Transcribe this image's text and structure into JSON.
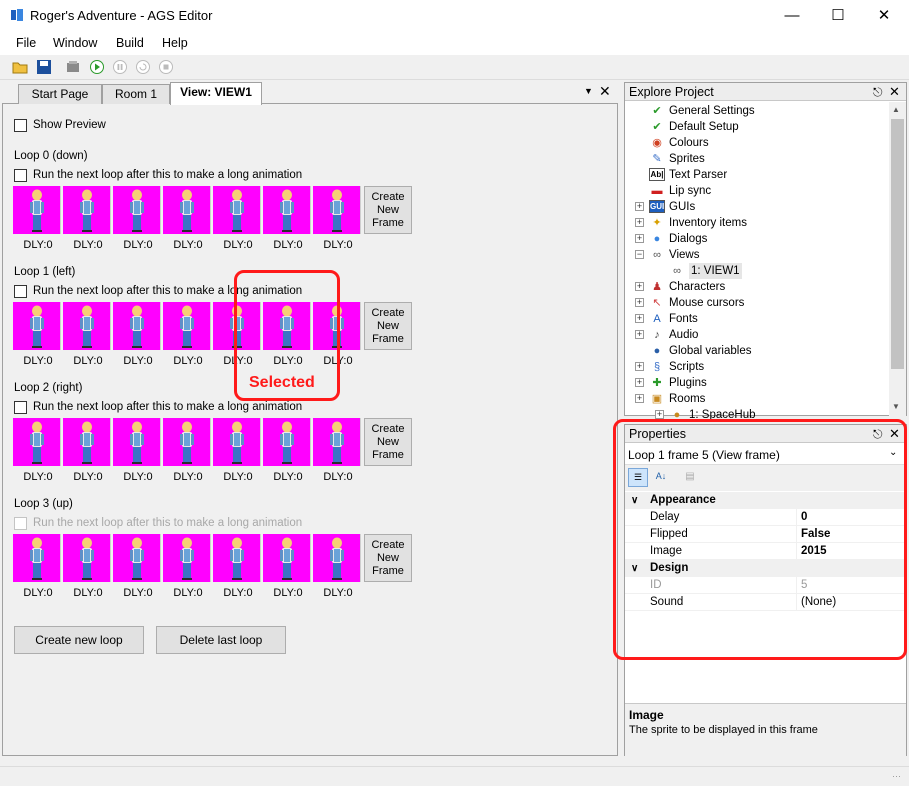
{
  "window": {
    "title": "Roger's Adventure - AGS Editor"
  },
  "menu": [
    "File",
    "Window",
    "Build",
    "Help"
  ],
  "tabs": [
    "Start Page",
    "Room 1",
    "View: VIEW1"
  ],
  "show_preview_label": "Show Preview",
  "run_next_label": "Run the next loop after this to make a long animation",
  "new_frame_label": [
    "Create",
    "New",
    "Frame"
  ],
  "delay_label": "DLY:0",
  "loops": [
    {
      "title": "Loop 0 (down)",
      "frames": 7,
      "checkbox_disabled": false
    },
    {
      "title": "Loop 1 (left)",
      "frames": 7,
      "checkbox_disabled": false
    },
    {
      "title": "Loop 2 (right)",
      "frames": 7,
      "checkbox_disabled": false
    },
    {
      "title": "Loop 3 (up)",
      "frames": 7,
      "checkbox_disabled": true
    }
  ],
  "buttons": {
    "create_loop": "Create new loop",
    "delete_loop": "Delete last loop"
  },
  "annotation": {
    "selected": "Selected"
  },
  "explore": {
    "title": "Explore Project",
    "items": [
      {
        "label": "General Settings",
        "icon": "check-icon"
      },
      {
        "label": "Default Setup",
        "icon": "check-icon"
      },
      {
        "label": "Colours",
        "icon": "palette-icon"
      },
      {
        "label": "Sprites",
        "icon": "sprites-icon"
      },
      {
        "label": "Text Parser",
        "icon": "text-parser-icon",
        "glyph": "Ab|"
      },
      {
        "label": "Lip sync",
        "icon": "lips-icon"
      },
      {
        "label": "GUIs",
        "icon": "gui-icon",
        "glyph": "GUI"
      },
      {
        "label": "Inventory items",
        "icon": "inventory-icon"
      },
      {
        "label": "Dialogs",
        "icon": "dialog-icon"
      },
      {
        "label": "Views",
        "icon": "views-icon"
      },
      {
        "label": "1: VIEW1",
        "icon": "view-icon"
      },
      {
        "label": "Characters",
        "icon": "characters-icon"
      },
      {
        "label": "Mouse cursors",
        "icon": "cursor-icon"
      },
      {
        "label": "Fonts",
        "icon": "fonts-icon"
      },
      {
        "label": "Audio",
        "icon": "audio-icon"
      },
      {
        "label": "Global variables",
        "icon": "globe-icon"
      },
      {
        "label": "Scripts",
        "icon": "scripts-icon"
      },
      {
        "label": "Plugins",
        "icon": "plugins-icon"
      },
      {
        "label": "Rooms",
        "icon": "rooms-icon"
      },
      {
        "label": "1: SpaceHub",
        "icon": "room-icon"
      }
    ]
  },
  "properties": {
    "title": "Properties",
    "object": "Loop 1 frame 5 (View frame)",
    "categories": [
      {
        "name": "Appearance",
        "rows": [
          {
            "name": "Delay",
            "value": "0"
          },
          {
            "name": "Flipped",
            "value": "False"
          },
          {
            "name": "Image",
            "value": "2015"
          }
        ]
      },
      {
        "name": "Design",
        "rows": [
          {
            "name": "ID",
            "value": "5"
          },
          {
            "name": "Sound",
            "value": "(None)"
          }
        ]
      }
    ],
    "help_title": "Image",
    "help_text": "The sprite to be displayed in this frame"
  }
}
